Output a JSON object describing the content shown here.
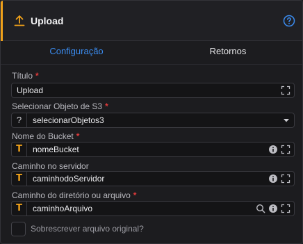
{
  "header": {
    "title": "Upload"
  },
  "tabs": [
    {
      "label": "Configuração",
      "active": true
    },
    {
      "label": "Retornos",
      "active": false
    }
  ],
  "fields": {
    "titulo": {
      "label": "Título",
      "value": "Upload"
    },
    "objeto_s3": {
      "label": "Selecionar Objeto de S3",
      "value": "selecionarObjetos3"
    },
    "bucket": {
      "label": "Nome do Bucket",
      "value": "nomeBucket"
    },
    "servidor": {
      "label": "Caminho no servidor",
      "value": "caminhodoServidor"
    },
    "arquivo": {
      "label": "Caminho do diretório ou arquivo",
      "value": "caminhoArquivo"
    }
  },
  "required_mark": "*",
  "prefix_glyphs": {
    "text": "T",
    "unknown": "?"
  },
  "checkbox": {
    "label": "Sobrescrever arquivo original?",
    "checked": false
  },
  "colors": {
    "accent": "#f0a11a",
    "link": "#3b8cf0",
    "required": "#e03b3b",
    "background": "#1c1c1f"
  }
}
